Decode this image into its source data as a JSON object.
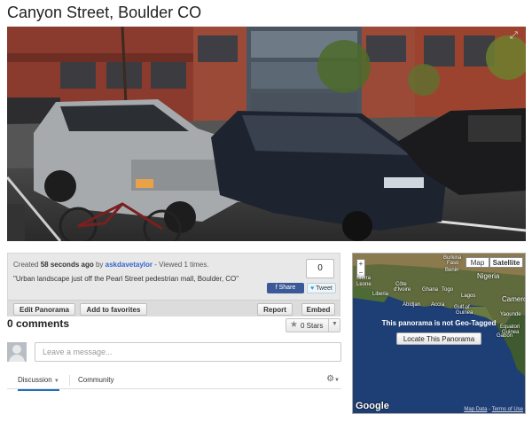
{
  "page": {
    "title": "Canyon Street, Boulder CO"
  },
  "panorama": {
    "fullscreen_icon": "expand-icon"
  },
  "info": {
    "created_prefix": "Created",
    "created_ago": "58 seconds ago",
    "by_word": "by",
    "author": "askdavetaylor",
    "views_text": "- Viewed 1 times.",
    "description": "\"Urban landscape just off the Pearl Street pedestrian mall, Boulder, CO\"",
    "count": "0",
    "facebook_label": "Share",
    "tweet_label": "Tweet"
  },
  "actions": {
    "edit": "Edit Panorama",
    "favorites": "Add to favorites",
    "report": "Report",
    "embed": "Embed"
  },
  "comments": {
    "title": "0 comments",
    "stars_label": "0 Stars",
    "placeholder": "Leave a message..."
  },
  "tabs": [
    {
      "label": "Discussion"
    },
    {
      "label": "Community"
    }
  ],
  "map": {
    "type_map": "Map",
    "type_satellite": "Satellite",
    "zoom_in": "+",
    "zoom_out": "−",
    "message": "This panorama is not Geo-Tagged",
    "locate_label": "Locate This Panorama",
    "labels": {
      "burkina": "Burkina",
      "faso": "Faso",
      "benin": "Benin",
      "nigeria": "Nigeria",
      "sierra": "Sierra",
      "leone": "Leone",
      "liberia": "Liberia",
      "cote": "Côte",
      "divoire": "d'Ivoire",
      "ghana": "Ghana",
      "togo": "Togo",
      "lagos": "Lagos",
      "abidjan": "Abidjan",
      "accra": "Accra",
      "gulf": "Gulf of",
      "guinea": "Guinea",
      "camero": "Camero",
      "yaounde": "Yaounde",
      "equatorial": "Equatori",
      "guinea2": "Guinea",
      "gabon": "Gabon"
    },
    "google": "Google",
    "map_data": "Map Data",
    "terms": "Terms of Use"
  },
  "colors": {
    "link": "#3366cc",
    "facebook": "#3b5998",
    "tab_active": "#1f6fbf",
    "ocean": "#1c3b6e"
  }
}
